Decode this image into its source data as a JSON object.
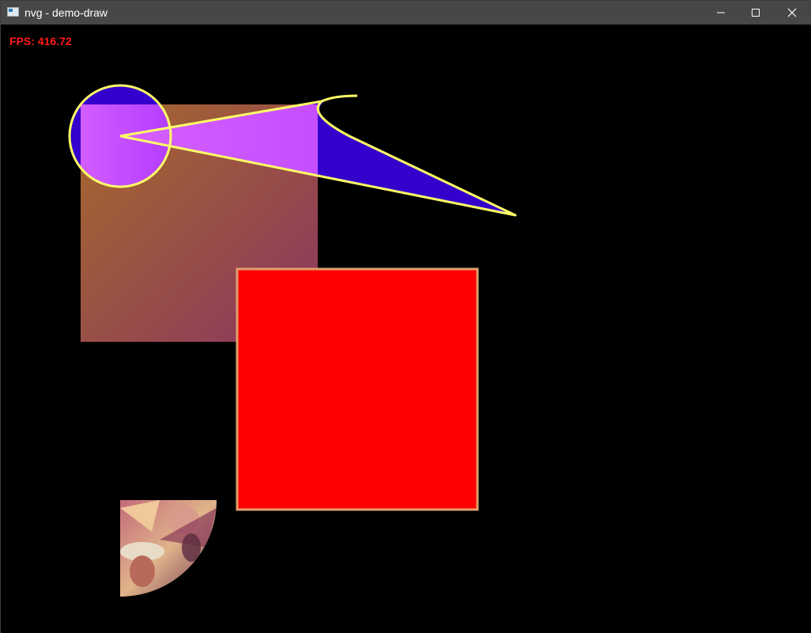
{
  "window": {
    "title": "nvg - demo-draw"
  },
  "titlebar_buttons": {
    "minimize_icon": "minimize-icon",
    "maximize_icon": "maximize-icon",
    "close_icon": "close-icon"
  },
  "canvas": {
    "fps_label": "FPS: 416.72",
    "colors": {
      "background": "#000000",
      "gradient_start": "#a85e36",
      "gradient_end": "#8a3a5e",
      "violet_fill": "#d257ff",
      "blue_fill": "#3300cc",
      "stroke_yellow": "#ffff66",
      "red_square": "#ff0000",
      "red_square_border": "#e0a070",
      "fps_text": "#ff1a1a"
    }
  }
}
